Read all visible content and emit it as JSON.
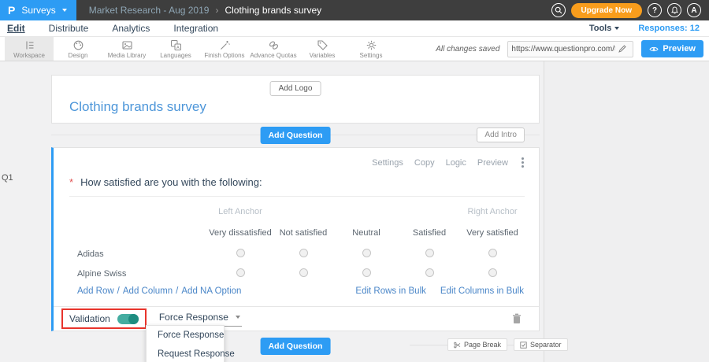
{
  "topbar": {
    "logo_glyph": "P",
    "product": "Surveys",
    "breadcrumb_parent": "Market Research - Aug 2019",
    "breadcrumb_sep": "›",
    "breadcrumb_current": "Clothing brands survey",
    "upgrade_label": "Upgrade Now",
    "help_glyph": "?",
    "avatar_glyph": "A"
  },
  "nav": {
    "items": [
      "Edit",
      "Distribute",
      "Analytics",
      "Integration"
    ],
    "tools_label": "Tools",
    "responses_label": "Responses: 12"
  },
  "toolbar": {
    "items": [
      "Workspace",
      "Design",
      "Media Library",
      "Languages",
      "Finish Options",
      "Advance Quotas",
      "Variables",
      "Settings"
    ],
    "saved_status": "All changes saved",
    "url_value": "https://www.questionpro.com/t/APNrFZ",
    "preview_label": "Preview"
  },
  "survey": {
    "add_logo_label": "Add Logo",
    "title": "Clothing brands survey",
    "add_question_label": "Add Question",
    "add_intro_label": "Add Intro"
  },
  "question": {
    "id": "Q1",
    "actions": [
      "Settings",
      "Copy",
      "Logic",
      "Preview"
    ],
    "required_marker": "*",
    "text": "How satisfied are you with the following:",
    "left_anchor": "Left Anchor",
    "right_anchor": "Right Anchor",
    "columns": [
      "Very dissatisfied",
      "Not satisfied",
      "Neutral",
      "Satisfied",
      "Very satisfied"
    ],
    "rows": [
      "Adidas",
      "Alpine Swiss"
    ],
    "add_row": "Add Row",
    "add_column": "Add Column",
    "add_na": "Add NA Option",
    "link_sep": "/",
    "edit_rows_bulk": "Edit Rows in Bulk",
    "edit_cols_bulk": "Edit Columns in Bulk",
    "validation_label": "Validation",
    "validation_selected": "Force Response",
    "validation_options": [
      "Force Response",
      "Request Response"
    ]
  },
  "footer": {
    "add_question_label": "Add Question",
    "page_break_label": "Page Break",
    "separator_label": "Separator"
  },
  "colors": {
    "accent_blue": "#2d9cf4",
    "upgrade_orange": "#f99d1c",
    "toggle_teal": "#44ada1",
    "highlight_red": "#e8342c",
    "title_blue": "#4d96d9",
    "link_blue": "#4a86c8"
  }
}
